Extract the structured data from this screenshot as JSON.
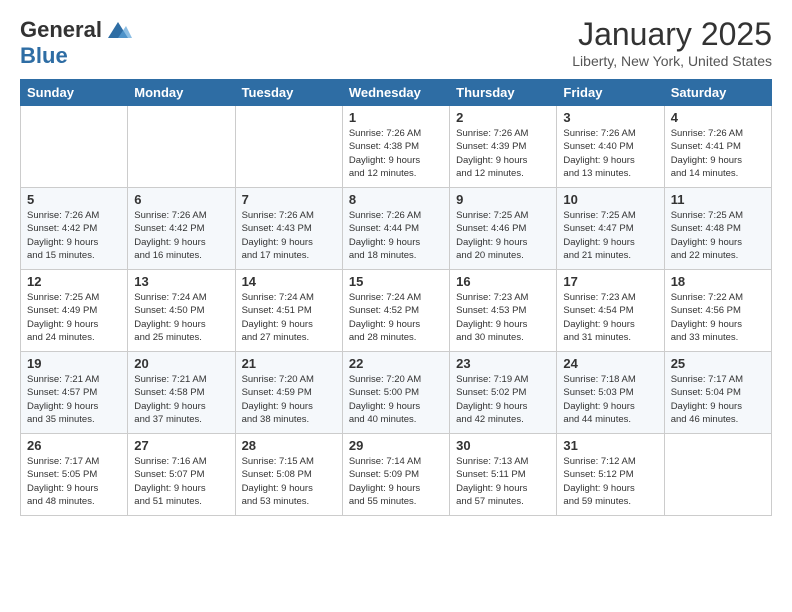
{
  "header": {
    "logo_line1": "General",
    "logo_line2": "Blue",
    "month": "January 2025",
    "location": "Liberty, New York, United States"
  },
  "days_of_week": [
    "Sunday",
    "Monday",
    "Tuesday",
    "Wednesday",
    "Thursday",
    "Friday",
    "Saturday"
  ],
  "weeks": [
    [
      {
        "day": "",
        "info": ""
      },
      {
        "day": "",
        "info": ""
      },
      {
        "day": "",
        "info": ""
      },
      {
        "day": "1",
        "info": "Sunrise: 7:26 AM\nSunset: 4:38 PM\nDaylight: 9 hours\nand 12 minutes."
      },
      {
        "day": "2",
        "info": "Sunrise: 7:26 AM\nSunset: 4:39 PM\nDaylight: 9 hours\nand 12 minutes."
      },
      {
        "day": "3",
        "info": "Sunrise: 7:26 AM\nSunset: 4:40 PM\nDaylight: 9 hours\nand 13 minutes."
      },
      {
        "day": "4",
        "info": "Sunrise: 7:26 AM\nSunset: 4:41 PM\nDaylight: 9 hours\nand 14 minutes."
      }
    ],
    [
      {
        "day": "5",
        "info": "Sunrise: 7:26 AM\nSunset: 4:42 PM\nDaylight: 9 hours\nand 15 minutes."
      },
      {
        "day": "6",
        "info": "Sunrise: 7:26 AM\nSunset: 4:42 PM\nDaylight: 9 hours\nand 16 minutes."
      },
      {
        "day": "7",
        "info": "Sunrise: 7:26 AM\nSunset: 4:43 PM\nDaylight: 9 hours\nand 17 minutes."
      },
      {
        "day": "8",
        "info": "Sunrise: 7:26 AM\nSunset: 4:44 PM\nDaylight: 9 hours\nand 18 minutes."
      },
      {
        "day": "9",
        "info": "Sunrise: 7:25 AM\nSunset: 4:46 PM\nDaylight: 9 hours\nand 20 minutes."
      },
      {
        "day": "10",
        "info": "Sunrise: 7:25 AM\nSunset: 4:47 PM\nDaylight: 9 hours\nand 21 minutes."
      },
      {
        "day": "11",
        "info": "Sunrise: 7:25 AM\nSunset: 4:48 PM\nDaylight: 9 hours\nand 22 minutes."
      }
    ],
    [
      {
        "day": "12",
        "info": "Sunrise: 7:25 AM\nSunset: 4:49 PM\nDaylight: 9 hours\nand 24 minutes."
      },
      {
        "day": "13",
        "info": "Sunrise: 7:24 AM\nSunset: 4:50 PM\nDaylight: 9 hours\nand 25 minutes."
      },
      {
        "day": "14",
        "info": "Sunrise: 7:24 AM\nSunset: 4:51 PM\nDaylight: 9 hours\nand 27 minutes."
      },
      {
        "day": "15",
        "info": "Sunrise: 7:24 AM\nSunset: 4:52 PM\nDaylight: 9 hours\nand 28 minutes."
      },
      {
        "day": "16",
        "info": "Sunrise: 7:23 AM\nSunset: 4:53 PM\nDaylight: 9 hours\nand 30 minutes."
      },
      {
        "day": "17",
        "info": "Sunrise: 7:23 AM\nSunset: 4:54 PM\nDaylight: 9 hours\nand 31 minutes."
      },
      {
        "day": "18",
        "info": "Sunrise: 7:22 AM\nSunset: 4:56 PM\nDaylight: 9 hours\nand 33 minutes."
      }
    ],
    [
      {
        "day": "19",
        "info": "Sunrise: 7:21 AM\nSunset: 4:57 PM\nDaylight: 9 hours\nand 35 minutes."
      },
      {
        "day": "20",
        "info": "Sunrise: 7:21 AM\nSunset: 4:58 PM\nDaylight: 9 hours\nand 37 minutes."
      },
      {
        "day": "21",
        "info": "Sunrise: 7:20 AM\nSunset: 4:59 PM\nDaylight: 9 hours\nand 38 minutes."
      },
      {
        "day": "22",
        "info": "Sunrise: 7:20 AM\nSunset: 5:00 PM\nDaylight: 9 hours\nand 40 minutes."
      },
      {
        "day": "23",
        "info": "Sunrise: 7:19 AM\nSunset: 5:02 PM\nDaylight: 9 hours\nand 42 minutes."
      },
      {
        "day": "24",
        "info": "Sunrise: 7:18 AM\nSunset: 5:03 PM\nDaylight: 9 hours\nand 44 minutes."
      },
      {
        "day": "25",
        "info": "Sunrise: 7:17 AM\nSunset: 5:04 PM\nDaylight: 9 hours\nand 46 minutes."
      }
    ],
    [
      {
        "day": "26",
        "info": "Sunrise: 7:17 AM\nSunset: 5:05 PM\nDaylight: 9 hours\nand 48 minutes."
      },
      {
        "day": "27",
        "info": "Sunrise: 7:16 AM\nSunset: 5:07 PM\nDaylight: 9 hours\nand 51 minutes."
      },
      {
        "day": "28",
        "info": "Sunrise: 7:15 AM\nSunset: 5:08 PM\nDaylight: 9 hours\nand 53 minutes."
      },
      {
        "day": "29",
        "info": "Sunrise: 7:14 AM\nSunset: 5:09 PM\nDaylight: 9 hours\nand 55 minutes."
      },
      {
        "day": "30",
        "info": "Sunrise: 7:13 AM\nSunset: 5:11 PM\nDaylight: 9 hours\nand 57 minutes."
      },
      {
        "day": "31",
        "info": "Sunrise: 7:12 AM\nSunset: 5:12 PM\nDaylight: 9 hours\nand 59 minutes."
      },
      {
        "day": "",
        "info": ""
      }
    ]
  ]
}
